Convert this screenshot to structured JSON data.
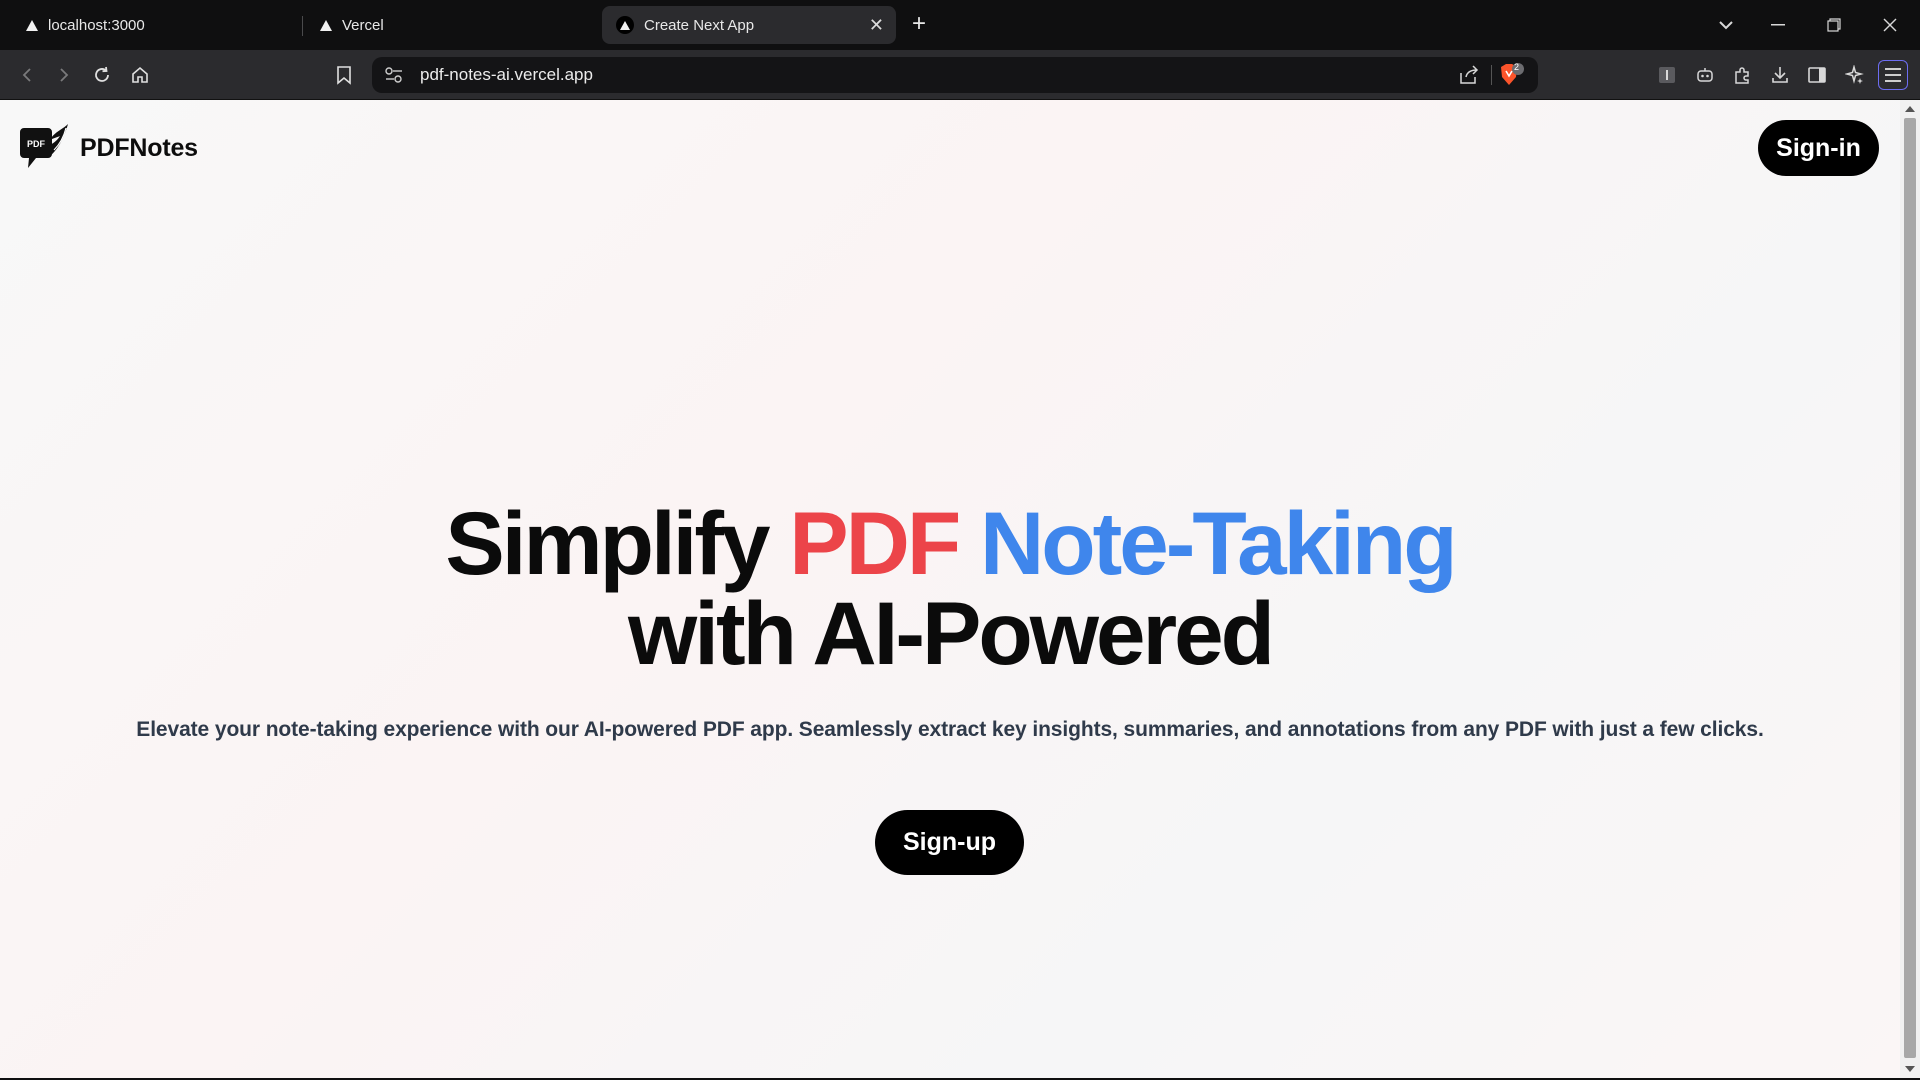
{
  "browser": {
    "tabs": [
      {
        "label": "localhost:3000",
        "active": false
      },
      {
        "label": "Vercel",
        "active": false
      },
      {
        "label": "Create Next App",
        "active": true
      }
    ],
    "url": "pdf-notes-ai.vercel.app",
    "shield_count": "2",
    "icons": [
      "back-icon",
      "forward-icon",
      "reload-icon",
      "home-icon",
      "bookmark-icon",
      "site-settings-icon",
      "share-icon",
      "brave-shield-icon",
      "reader-mode-icon",
      "leo-icon",
      "extensions-icon",
      "downloads-icon",
      "sidebar-icon",
      "leo-ai-icon",
      "menu-icon",
      "tab-search-icon",
      "minimize-icon",
      "restore-icon",
      "close-icon",
      "new-tab-icon"
    ]
  },
  "page": {
    "brand": "PDFNotes",
    "logo_badge": "PDF",
    "signin_label": "Sign-in",
    "hero": {
      "part1": "Simplify ",
      "part2": "PDF",
      "part3": " Note-Taking",
      "line2": "with AI-Powered"
    },
    "subtitle": "Elevate your note-taking experience with our AI-powered PDF app. Seamlessly extract key insights, summaries, and annotations from any PDF with just a few clicks.",
    "signup_label": "Sign-up"
  },
  "colors": {
    "accent_red": "#ec4449",
    "accent_blue": "#3f86ec",
    "button_bg": "#000000"
  }
}
